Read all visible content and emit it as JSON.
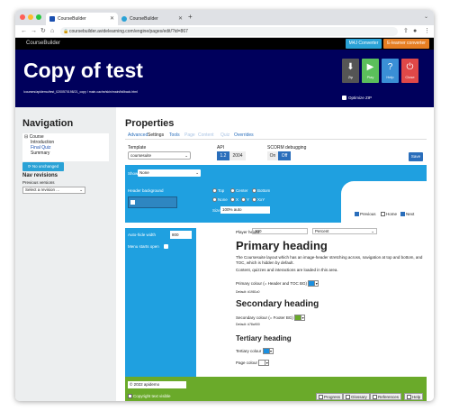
{
  "browser": {
    "tabs": [
      {
        "title": "CourseBuilder",
        "active": true
      },
      {
        "title": "CourseBuilder",
        "active": false
      }
    ],
    "url": "coursebuilder.avidelearning.com/engine/pages/edit/?id=867",
    "colors": {
      "close": "#ff5f57",
      "minimize": "#febc2e",
      "maximize": "#28c840"
    }
  },
  "app": {
    "brand": "CourseBuilder",
    "m_converter": "M4J Converter",
    "e_converter": "E-learner converter"
  },
  "header": {
    "title": "Copy of test",
    "path": "/courses/apidemo/test_0200570198/21_copy / main.cache/skin/main/fallback.html",
    "buttons": [
      {
        "label": "Zip",
        "icon": "download-icon",
        "glyph": "⬇",
        "color": "#555555"
      },
      {
        "label": "Play",
        "icon": "play-icon",
        "glyph": "▶",
        "color": "#5bbf5b"
      },
      {
        "label": "Help",
        "icon": "help-icon",
        "glyph": "?",
        "color": "#3a8fd6"
      },
      {
        "label": "Close",
        "icon": "power-icon",
        "glyph": "⏻",
        "color": "#e04848"
      }
    ],
    "optimize_zip": "Optimize ZIP"
  },
  "navigation": {
    "heading": "Navigation",
    "tree": [
      "Course",
      "Introduction",
      "Final Quiz",
      "Summary"
    ],
    "no_changes": "No unchanged",
    "revisions_heading": "Nav revisions",
    "previous_label": "Previous versions",
    "revision_select": "Select a revision ..."
  },
  "properties": {
    "heading": "Properties",
    "tabs": [
      "Advanced",
      "Settings",
      "Tools",
      "Page",
      "Content",
      "Quiz",
      "Overrides"
    ],
    "template_label": "Template",
    "template_value": "coursesuite",
    "api_label": "API",
    "api_options": [
      "1.2",
      "2004"
    ],
    "scorm_label": "SCORM debugging",
    "scorm_options": [
      "On",
      "Off"
    ],
    "save": "Save",
    "show_label": "Show",
    "show_value": "None",
    "header_bg_label": "Header background",
    "position_radios": [
      "Top",
      "Center",
      "Bottom"
    ],
    "repeat_radios": [
      "None",
      "X",
      "Y",
      "XxY"
    ],
    "size_label": "Size",
    "size_value": "100% auto",
    "nav_checks": [
      {
        "label": "Previous",
        "checked": true
      },
      {
        "label": "Home",
        "checked": false
      },
      {
        "label": "Next",
        "checked": true
      }
    ],
    "autohide_label": "Auto-hide width",
    "autohide_value": "800",
    "menu_starts_open": "Menu starts open",
    "player_height_label": "Player height",
    "player_height_value": "100",
    "player_height_unit": "Percent",
    "primary_heading": "Primary heading",
    "para1": "The Coursesuite layout which has an image-header stretching across, navigation at top and bottom, and TOC, which is hidden by default.",
    "para2": "Content, quizzes and interactions are loaded in this area.",
    "primary_colour_label": "Primary colour (= Header and TOC BG)",
    "primary_default": "Default: #1981c0",
    "secondary_heading": "Secondary heading",
    "secondary_colour_label": "Secondary colour (= Footer BG)",
    "secondary_default": "Default: #78a900",
    "tertiary_heading": "Tertiary heading",
    "tertiary_colour_label": "Tertiary colour",
    "page_colour_label": "Page colour",
    "copyright_value": "© 2022 apidemo",
    "copyright_visible": "Copyright text visible",
    "footer_checks": [
      "Progress",
      "Glossary",
      "References",
      "Help"
    ],
    "colors": {
      "primary": "#1a8fe0",
      "secondary": "#6aaa2a",
      "tertiary": "#1a8fe0",
      "page": "#ffffff",
      "header_bg": "#00005c",
      "panel_blue": "#1fa0e0"
    }
  }
}
